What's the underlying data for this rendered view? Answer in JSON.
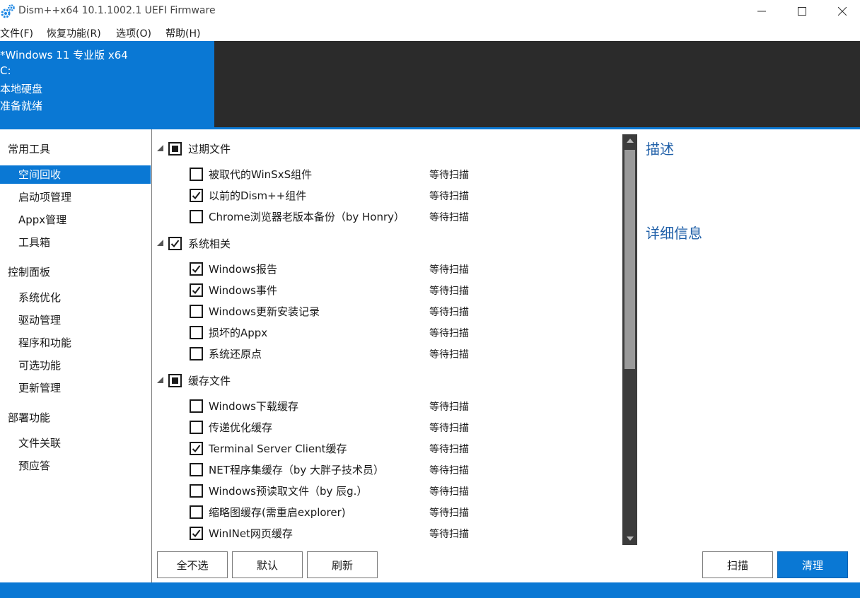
{
  "window": {
    "title": "Dism++x64 10.1.1002.1 UEFI Firmware",
    "icon": "gear-icon",
    "accent_color": "#0a78d4"
  },
  "menu": [
    "文件(F)",
    "恢复功能(R)",
    "选项(O)",
    "帮助(H)"
  ],
  "info": {
    "os": "*Windows 11 专业版 x64",
    "drive": "C:",
    "disk": "本地硬盘",
    "status": "准备就绪"
  },
  "sidebar": {
    "sections": [
      {
        "header": "常用工具",
        "items": [
          "空间回收",
          "启动项管理",
          "Appx管理",
          "工具箱"
        ]
      },
      {
        "header": "控制面板",
        "items": [
          "系统优化",
          "驱动管理",
          "程序和功能",
          "可选功能",
          "更新管理"
        ]
      },
      {
        "header": "部署功能",
        "items": [
          "文件关联",
          "预应答"
        ]
      }
    ],
    "selected": "空间回收"
  },
  "cleanup": {
    "groups": [
      {
        "label": "过期文件",
        "state": "partial",
        "items": [
          {
            "label": "被取代的WinSxS组件",
            "checked": false,
            "status": "等待扫描"
          },
          {
            "label": "以前的Dism++组件",
            "checked": true,
            "status": "等待扫描"
          },
          {
            "label": "Chrome浏览器老版本备份（by Honry）",
            "checked": false,
            "status": "等待扫描"
          }
        ]
      },
      {
        "label": "系统相关",
        "state": "checked",
        "items": [
          {
            "label": "Windows报告",
            "checked": true,
            "status": "等待扫描"
          },
          {
            "label": "Windows事件",
            "checked": true,
            "status": "等待扫描"
          },
          {
            "label": "Windows更新安装记录",
            "checked": false,
            "status": "等待扫描"
          },
          {
            "label": "损坏的Appx",
            "checked": false,
            "status": "等待扫描"
          },
          {
            "label": "系统还原点",
            "checked": false,
            "status": "等待扫描"
          }
        ]
      },
      {
        "label": "缓存文件",
        "state": "partial",
        "items": [
          {
            "label": "Windows下载缓存",
            "checked": false,
            "status": "等待扫描"
          },
          {
            "label": "传递优化缓存",
            "checked": false,
            "status": "等待扫描"
          },
          {
            "label": "Terminal Server Client缓存",
            "checked": true,
            "status": "等待扫描"
          },
          {
            "label": "NET程序集缓存（by 大胖子技术员）",
            "checked": false,
            "status": "等待扫描"
          },
          {
            "label": "Windows预读取文件（by 辰g.）",
            "checked": false,
            "status": "等待扫描"
          },
          {
            "label": "缩略图缓存(需重启explorer)",
            "checked": false,
            "status": "等待扫描"
          },
          {
            "label": "WinINet网页缓存",
            "checked": true,
            "status": "等待扫描"
          }
        ]
      }
    ]
  },
  "right_panel": {
    "desc_title": "描述",
    "detail_title": "详细信息"
  },
  "buttons": {
    "select_none": "全不选",
    "default": "默认",
    "refresh": "刷新",
    "scan": "扫描",
    "clean": "清理"
  }
}
